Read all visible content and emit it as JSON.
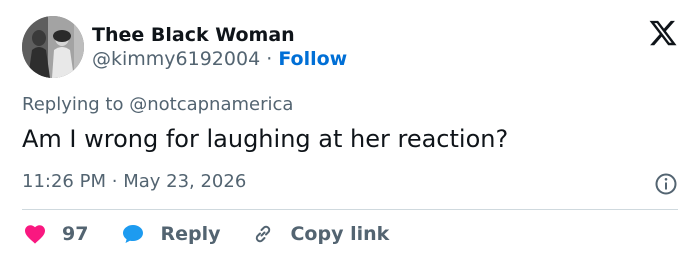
{
  "tweet": {
    "author": {
      "display_name": "Thee Black Woman",
      "handle": "@kimmy6192004",
      "separator": "·",
      "follow_label": "Follow",
      "avatar_icon": "avatar-photo"
    },
    "platform_icon": "x-logo-icon",
    "replying_to": {
      "prefix": "Replying to",
      "mention": "@notcapnamerica"
    },
    "text": "Am I wrong for laughing at her reaction?",
    "timestamp": {
      "time": "11:26 PM",
      "separator": "·",
      "date": "May 23, 2026"
    },
    "info_icon": "info-icon",
    "actions": {
      "like": {
        "icon": "heart-icon",
        "count": "97",
        "color": "#f91880"
      },
      "reply": {
        "icon": "speech-bubble-icon",
        "label": "Reply",
        "color": "#1d9bf0"
      },
      "copy_link": {
        "icon": "link-icon",
        "label": "Copy link"
      }
    },
    "colors": {
      "follow": "#006fd6",
      "secondary_text": "#536471",
      "primary_text": "#0f1419",
      "divider": "#cfd9de"
    }
  }
}
